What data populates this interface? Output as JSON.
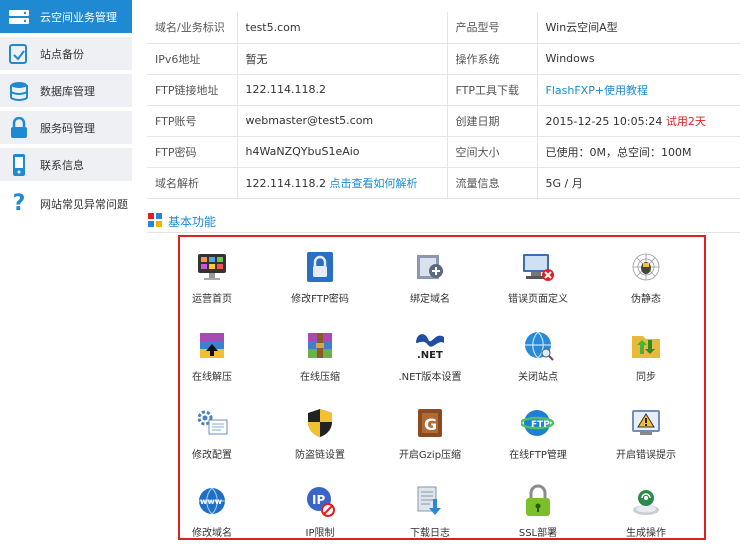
{
  "sidebar": {
    "items": [
      {
        "label": "云空间业务管理",
        "icon": "server-icon",
        "active": true
      },
      {
        "label": "站点备份",
        "icon": "backup-icon"
      },
      {
        "label": "数据库管理",
        "icon": "database-icon"
      },
      {
        "label": "服务码管理",
        "icon": "lock-icon"
      },
      {
        "label": "联系信息",
        "icon": "phone-icon"
      },
      {
        "label": "网站常见异常问题",
        "icon": "question-icon"
      }
    ]
  },
  "info": {
    "rows": [
      {
        "k1": "域名/业务标识",
        "v1": "test5.com",
        "k2": "产品型号",
        "v2": "Win云空间A型"
      },
      {
        "k1": "IPv6地址",
        "v1": "暂无",
        "k2": "操作系统",
        "v2": "Windows"
      },
      {
        "k1": "FTP链接地址",
        "v1": "122.114.118.2",
        "k2": "FTP工具下载",
        "v2_link": "FlashFXP+使用教程"
      },
      {
        "k1": "FTP账号",
        "v1": "webmaster@test5.com",
        "k2": "创建日期",
        "v2": "2015-12-25 10:05:24",
        "v2_red": "试用2天"
      },
      {
        "k1": "FTP密码",
        "v1": "h4WaNZQYbuS1eAio",
        "k2": "空间大小",
        "v2": "已使用：0M，总空间：100M"
      },
      {
        "k1": "域名解析",
        "v1": "122.114.118.2",
        "v1_link": "点击查看如何解析",
        "k2": "流量信息",
        "v2": "5G / 月"
      }
    ]
  },
  "section": {
    "title": "基本功能",
    "icon": "grid-icon"
  },
  "functions": [
    {
      "label": "运营首页",
      "icon": "monitor-icon"
    },
    {
      "label": "修改FTP密码",
      "icon": "ftp-lock-icon"
    },
    {
      "label": "绑定域名",
      "icon": "bind-domain-icon"
    },
    {
      "label": "错误页面定义",
      "icon": "error-page-icon"
    },
    {
      "label": "伪静态",
      "icon": "spider-icon"
    },
    {
      "label": "在线解压",
      "icon": "unzip-icon"
    },
    {
      "label": "在线压缩",
      "icon": "zip-icon"
    },
    {
      "label": ".NET版本设置",
      "icon": "dotnet-icon"
    },
    {
      "label": "关闭站点",
      "icon": "globe-icon"
    },
    {
      "label": "同步",
      "icon": "sync-folder-icon"
    },
    {
      "label": "修改配置",
      "icon": "config-icon"
    },
    {
      "label": "防盗链设置",
      "icon": "shield-icon"
    },
    {
      "label": "开启Gzip压缩",
      "icon": "gzip-icon"
    },
    {
      "label": "在线FTP管理",
      "icon": "ftp-globe-icon"
    },
    {
      "label": "开启错误提示",
      "icon": "warning-icon"
    },
    {
      "label": "修改域名",
      "icon": "www-icon"
    },
    {
      "label": "IP限制",
      "icon": "ip-icon"
    },
    {
      "label": "下载日志",
      "icon": "download-log-icon"
    },
    {
      "label": "SSL部署",
      "icon": "ssl-lock-icon"
    },
    {
      "label": "生成操作",
      "icon": "generate-icon"
    }
  ],
  "colors": {
    "accent": "#1f8ad1",
    "alert": "#e02020"
  }
}
